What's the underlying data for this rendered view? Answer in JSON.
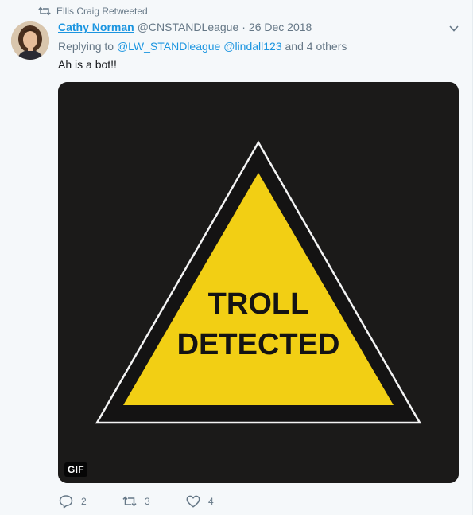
{
  "retweet_context": {
    "text": "Ellis Craig Retweeted",
    "icon": "retweet-icon"
  },
  "author": {
    "fullname": "Cathy Norman",
    "username": "@CNSTANDLeague",
    "separator": "·",
    "timestamp": "26 Dec 2018"
  },
  "reply_context": {
    "prefix": "Replying to",
    "mention1": "@LW_STANDleague",
    "mention2": "@lindall123",
    "suffix": "and 4 others"
  },
  "tweet": {
    "text": "Ah is a bot!!"
  },
  "media": {
    "sign_line1": "TROLL",
    "sign_line2": "DETECTED",
    "badge": "GIF",
    "colors": {
      "background": "#1b1a19",
      "sign_yellow": "#f2cf14",
      "sign_border": "#ffffff"
    }
  },
  "actions": {
    "reply_count": "2",
    "retweet_count": "3",
    "like_count": "4"
  },
  "colors": {
    "link": "#1b95e0",
    "muted": "#657786",
    "background": "#f5f8fa"
  }
}
